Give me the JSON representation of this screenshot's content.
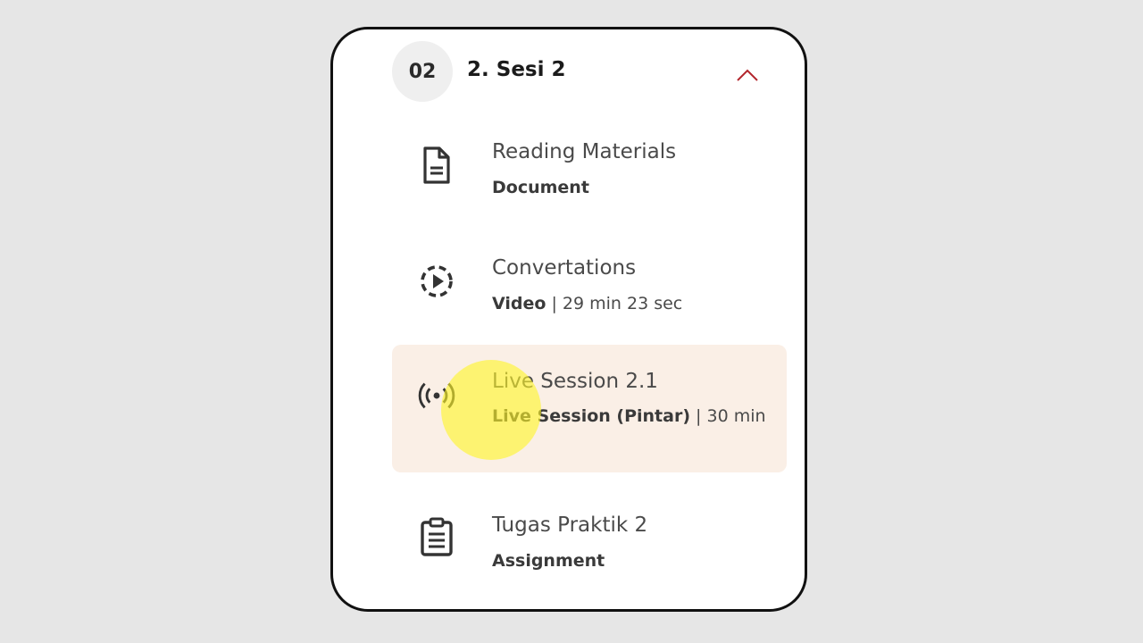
{
  "section": {
    "number": "02",
    "title": "2. Sesi 2",
    "collapse_icon": "chevron-up-icon",
    "accent_color": "#b3262d"
  },
  "items": [
    {
      "title": "Reading Materials",
      "type": "Document",
      "detail": "",
      "icon": "document-icon"
    },
    {
      "title": "Convertations",
      "type": "Video",
      "separator": " | ",
      "detail": "29 min 23 sec",
      "icon": "play-circle-icon"
    },
    {
      "title": "Live Session 2.1",
      "type": "Live Session (Pintar)",
      "separator": " | ",
      "detail": "30 min",
      "icon": "broadcast-icon",
      "active": true
    },
    {
      "title": "Tugas Praktik 2",
      "type": "Assignment",
      "detail": "",
      "icon": "clipboard-icon"
    }
  ],
  "colors": {
    "active_background": "#faefe6",
    "cursor_highlight": "#fff528"
  }
}
